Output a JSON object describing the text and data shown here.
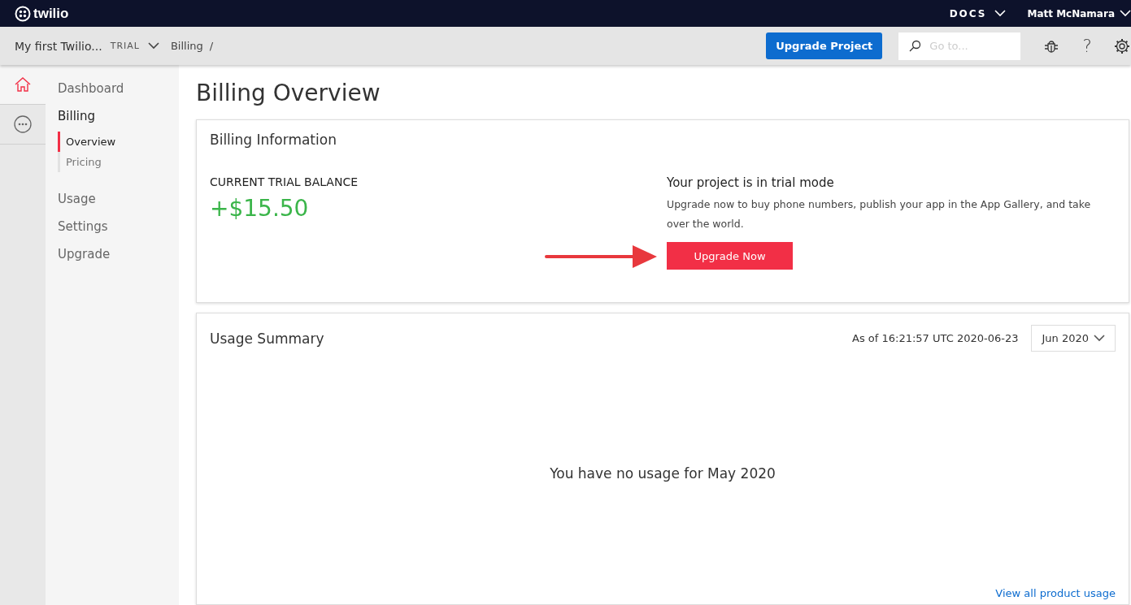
{
  "topbar": {
    "brand": "twilio",
    "docs": "DOCS",
    "user": "Matt McNamara"
  },
  "subbar": {
    "project": "My first Twilio...",
    "badge": "TRIAL",
    "breadcrumb": "Billing",
    "separator": "/",
    "upgrade_button": "Upgrade Project",
    "search": {
      "placeholder": "Go to..."
    },
    "help": "?"
  },
  "rail": [
    {
      "kind": "home",
      "selected": true
    },
    {
      "kind": "more",
      "selected": false
    }
  ],
  "sidebar": {
    "items": [
      {
        "label": "Dashboard",
        "selected": false
      },
      {
        "label": "Billing",
        "selected": true,
        "children": [
          {
            "label": "Overview",
            "selected": true
          },
          {
            "label": "Pricing",
            "selected": false
          }
        ]
      },
      {
        "label": "Usage",
        "selected": false
      },
      {
        "label": "Settings",
        "selected": false
      },
      {
        "label": "Upgrade",
        "selected": false
      }
    ]
  },
  "page_title": "Billing Overview",
  "billing_card": {
    "title": "Billing Information",
    "balance_label": "CURRENT TRIAL BALANCE",
    "balance": "+$15.50",
    "trial_heading": "Your project is in trial mode",
    "trial_text": "Upgrade now to buy phone numbers, publish your app in the App Gallery, and take over the world.",
    "button": "Upgrade Now"
  },
  "usage_card": {
    "title": "Usage Summary",
    "as_of": "As of 16:21:57 UTC 2020-06-23",
    "month": "Jun 2020",
    "empty_message": "You have no usage for May 2020",
    "link": "View all product usage"
  }
}
